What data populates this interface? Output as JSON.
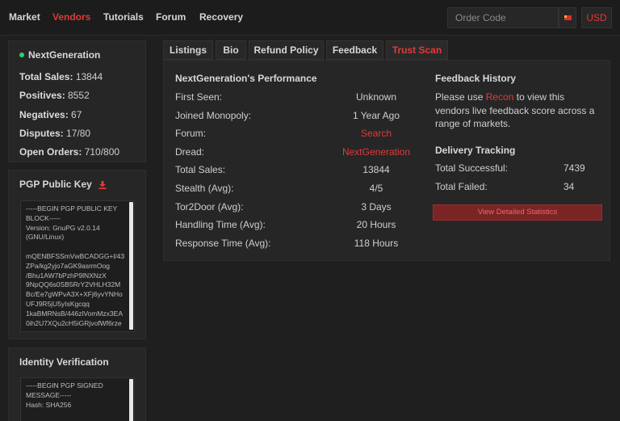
{
  "nav": {
    "items": [
      "Market",
      "Vendors",
      "Tutorials",
      "Forum",
      "Recovery"
    ],
    "active": "Vendors",
    "order_code_placeholder": "Order Code",
    "currency": "USD",
    "flag_icon": "flag-icon",
    "accent_color": "#e03a3a"
  },
  "vendor": {
    "name": "NextGeneration",
    "status": "online",
    "stats": [
      {
        "label": "Total Sales:",
        "value": "13844"
      },
      {
        "label": "Positives:",
        "value": "8552"
      },
      {
        "label": "Negatives:",
        "value": "67"
      },
      {
        "label": "Disputes:",
        "value": "17/80"
      },
      {
        "label": "Open Orders:",
        "value": "710/800"
      }
    ]
  },
  "pgp": {
    "title": "PGP Public Key",
    "icon": "download-icon",
    "lines": [
      "-----BEGIN PGP PUBLIC KEY",
      "BLOCK-----",
      "Version: GnuPG v2.0.14",
      "(GNU/Linux)",
      "",
      "mQENBFSSmVwBCADGG+l/43",
      "ZPa/kg2yjo7aGK9asrmOog",
      "/Bhu1AW7bPzhP9lNXNzX",
      "9NpQQ6s0SB5RrY2VHLH32M",
      "Bc/Ee7gWPvA3X+XFj6yvYNHo",
      "UFJ9R5jU5yIsKgcqq",
      "1kaBMRNsB/446zlVomMzx3EA",
      "0ih2U7XQu2cH5iGRjvofWf6rze"
    ]
  },
  "identity": {
    "title": "Identity Verification",
    "lines": [
      "-----BEGIN PGP SIGNED",
      "MESSAGE-----",
      "Hash: SHA256"
    ]
  },
  "tabs": [
    {
      "label": "Listings",
      "active": false
    },
    {
      "label": "Bio",
      "active": false
    },
    {
      "label": "Refund Policy",
      "active": false
    },
    {
      "label": "Feedback",
      "active": false
    },
    {
      "label": "Trust Scan",
      "active": true
    }
  ],
  "performance": {
    "title": "NextGeneration's Performance",
    "rows": [
      {
        "label": "First Seen:",
        "value": "Unknown",
        "link": false
      },
      {
        "label": "Joined Monopoly:",
        "value": "1 Year Ago",
        "link": false
      },
      {
        "label": "Forum:",
        "value": "Search",
        "link": true
      },
      {
        "label": "Dread:",
        "value": "NextGeneration",
        "link": true
      },
      {
        "label": "Total Sales:",
        "value": "13844",
        "link": false
      },
      {
        "label": "Stealth (Avg):",
        "value": "4/5",
        "link": false
      },
      {
        "label": "Tor2Door (Avg):",
        "value": "3 Days",
        "link": false
      },
      {
        "label": "Handling Time (Avg):",
        "value": "20 Hours",
        "link": false
      },
      {
        "label": "Response Time (Avg):",
        "value": "118 Hours",
        "link": false
      }
    ]
  },
  "feedback_history": {
    "title": "Feedback History",
    "text_before": "Please use ",
    "link": "Recon",
    "text_after": " to view this vendors live feedback score across a range of markets."
  },
  "delivery": {
    "title": "Delivery Tracking",
    "rows": [
      {
        "label": "Total Successful:",
        "value": "7439"
      },
      {
        "label": "Total Failed:",
        "value": "34"
      }
    ],
    "button": "View Detailed Statistics"
  }
}
